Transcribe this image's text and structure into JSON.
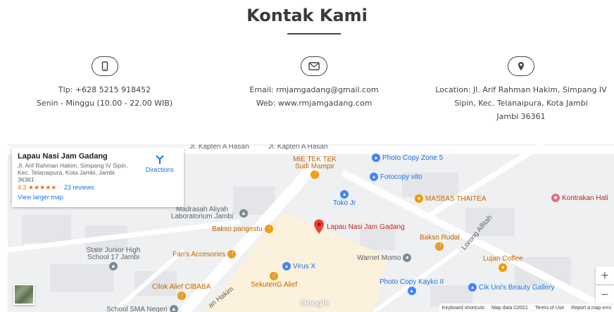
{
  "header": {
    "title": "Kontak Kami"
  },
  "contacts": {
    "phone": {
      "icon": "phone-icon",
      "line1": "Tlp: +628 5215 918452",
      "line2": "Senin - Minggu (10.00 - 22.00 WIB)"
    },
    "email": {
      "icon": "mail-icon",
      "line1": "Email: rmjamgadang@gmail.com",
      "line2": "Web: www.rmjamgadang.com"
    },
    "location": {
      "icon": "location-pin-icon",
      "line1": "Location: Jl. Arif Rahman Hakim, Simpang IV",
      "line2": "Sipin, Kec. Telanaipura, Kota Jambi",
      "line3": "Jambi 36361"
    }
  },
  "map": {
    "info_card": {
      "name": "Lapau Nasi Jam Gadang",
      "address": "Jl. Arif Rahman Hakim, Simpang IV Sipin, Kec. Telanaipura, Kota Jambi, Jambi 36361",
      "rating": "4.3",
      "stars": "★★★★★",
      "reviews": "23 reviews",
      "larger_map": "View larger map",
      "directions": "Directions"
    },
    "streets": {
      "street1": "Jl. Kapten A Hasan",
      "street2": "Jl. Kapten A Hasan",
      "street3": "Lorong Alfitah",
      "street4": "an Hakim"
    },
    "pois": {
      "mie": "MIE TEK TEK Sudi Mampir",
      "photocopy_zone": "Photo Copy Zone 5",
      "fotocopy_vito": "Fotocopy vito",
      "masbas": "MASBAS THAITEA",
      "kontrakan": "Kontrakan Hali",
      "toko_jr": "Toko Jr",
      "madrasah": "Madrasah Aliyah Laboratorium Jambi",
      "bakso_pangestu": "Bakso pangestu",
      "lapau": "Lapau Nasi Jam Gadang",
      "bakso_rudal": "Bakso Rudal",
      "state_junior": "State Junior High School 17 Jambi",
      "fans": "Fan's Accesories",
      "warnet": "Warnet Momo",
      "lujan": "Lujan Coffee",
      "virus": "Virus X",
      "cilok": "Cilok Alief CIBABA",
      "sekuteng": "SekutenG Alief",
      "photocopy_kayko": "Photo Copy Kayko II",
      "cik_uni": "Cik Uni's Beauty Gallery",
      "sma": "School SMA Negeri"
    },
    "google": "Google",
    "footer": {
      "keyboard": "Keyboard shortcuts",
      "mapdata": "Map data ©2021",
      "terms": "Terms of Use",
      "report": "Report a map erro"
    },
    "zoom_in": "+",
    "zoom_out": "−"
  }
}
